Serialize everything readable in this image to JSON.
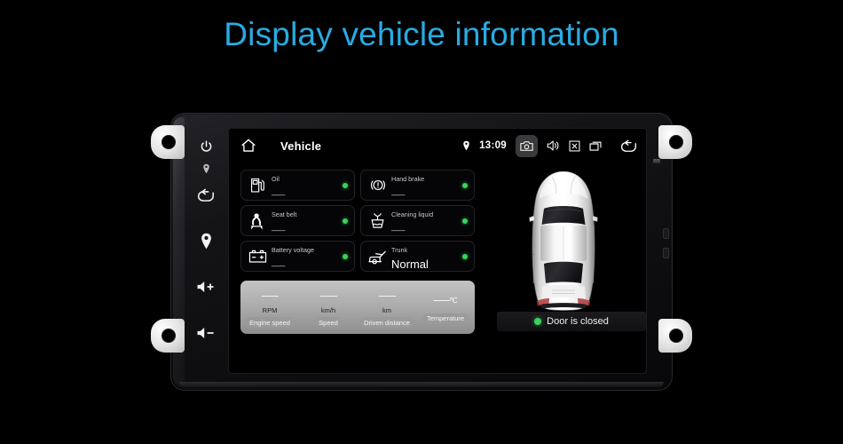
{
  "title": "Display vehicle information",
  "accent_color": "#29abe2",
  "status_ok_color": "#3ad15c",
  "statusbar": {
    "home_icon": "home-icon",
    "title": "Vehicle",
    "location_icon": "location-pin-icon",
    "clock": "13:09",
    "camera_icon": "camera-icon",
    "volume_icon": "speaker-icon",
    "close_icon": "close-box-icon",
    "recents_icon": "recent-apps-icon",
    "back_icon": "back-arrow-icon"
  },
  "hardware_keys": [
    {
      "name": "power-icon"
    },
    {
      "name": "led-indicator-icon"
    },
    {
      "name": "back-arrow-icon"
    },
    {
      "name": "navigation-pin-icon"
    },
    {
      "name": "volume-up-icon"
    },
    {
      "name": "volume-down-icon"
    }
  ],
  "cards": [
    {
      "icon": "fuel-pump-icon",
      "label": "Oil",
      "value": "——",
      "status": "ok",
      "big": false
    },
    {
      "icon": "hand-brake-icon",
      "label": "Hand brake",
      "value": "——",
      "status": "ok",
      "big": false
    },
    {
      "icon": "seat-belt-icon",
      "label": "Seat belt",
      "value": "——",
      "status": "ok",
      "big": false
    },
    {
      "icon": "cleaning-liquid-icon",
      "label": "Cleaning liquid",
      "value": "——",
      "status": "ok",
      "big": false
    },
    {
      "icon": "battery-icon",
      "label": "Battery voltage",
      "value": "——",
      "status": "ok",
      "big": false
    },
    {
      "icon": "trunk-icon",
      "label": "Trunk",
      "value": "Normal",
      "status": "ok",
      "big": true
    }
  ],
  "stats": [
    {
      "value": "——",
      "unit": "RPM",
      "label": "Engine speed"
    },
    {
      "value": "——",
      "unit": "km/h",
      "label": "Speed"
    },
    {
      "value": "——",
      "unit": "km",
      "label": "Driven distance"
    },
    {
      "value": "——",
      "degree": "℃",
      "unit": "",
      "label": "Temperature"
    }
  ],
  "car": {
    "icon": "car-top-view-image",
    "door_status": "Door is closed",
    "door_status_color": "#3ad15c"
  }
}
